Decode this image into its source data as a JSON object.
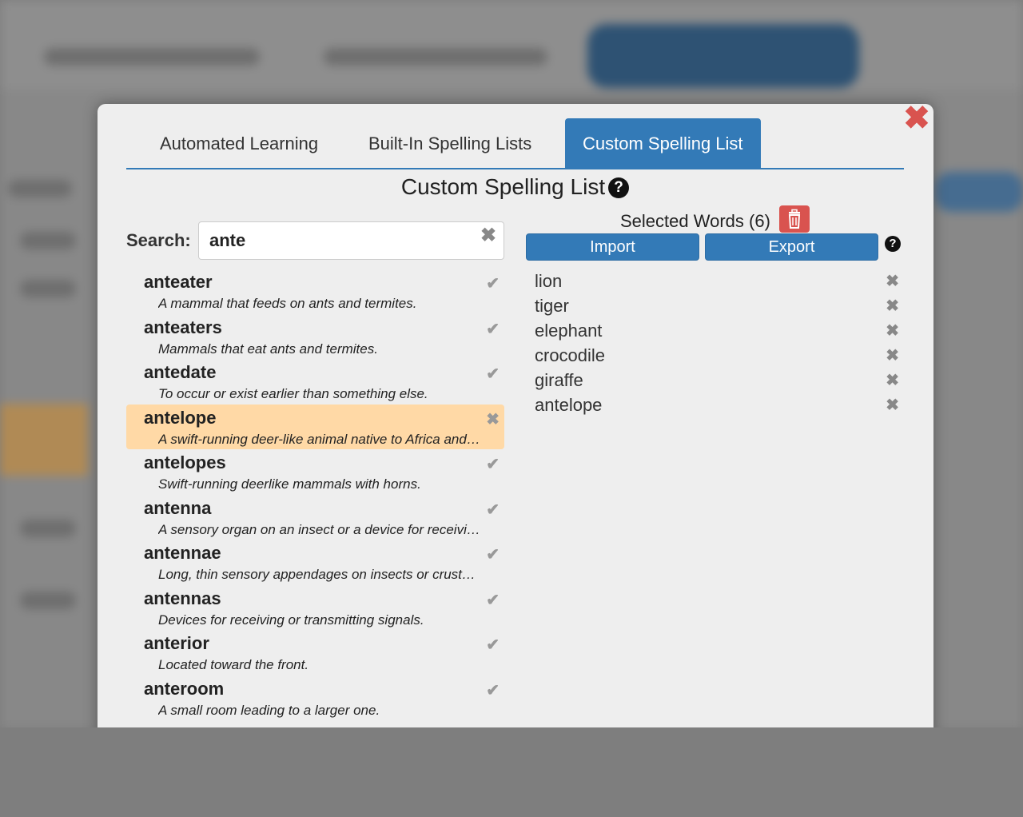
{
  "tabs": [
    {
      "label": "Automated Learning"
    },
    {
      "label": "Built-In Spelling Lists"
    },
    {
      "label": "Custom Spelling List"
    }
  ],
  "title": "Custom Spelling List",
  "search": {
    "label": "Search:",
    "value": "ante"
  },
  "results": [
    {
      "word": "anteater",
      "definition": "A mammal that feeds on ants and termites.",
      "selected": false
    },
    {
      "word": "anteaters",
      "definition": "Mammals that eat ants and termites.",
      "selected": false
    },
    {
      "word": "antedate",
      "definition": "To occur or exist earlier than something else.",
      "selected": false
    },
    {
      "word": "antelope",
      "definition": "A swift-running deer-like animal native to Africa and Asia.",
      "selected": true
    },
    {
      "word": "antelopes",
      "definition": "Swift-running deerlike mammals with horns.",
      "selected": false
    },
    {
      "word": "antenna",
      "definition": "A sensory organ on an insect or a device for receiving signals.",
      "selected": false
    },
    {
      "word": "antennae",
      "definition": "Long, thin sensory appendages on insects or crustaceans.",
      "selected": false
    },
    {
      "word": "antennas",
      "definition": "Devices for receiving or transmitting signals.",
      "selected": false
    },
    {
      "word": "anterior",
      "definition": "Located toward the front.",
      "selected": false
    },
    {
      "word": "anteroom",
      "definition": "A small room leading to a larger one.",
      "selected": false
    }
  ],
  "selected_words": {
    "header": "Selected Words (6)",
    "import_label": "Import",
    "export_label": "Export",
    "words": [
      "lion",
      "tiger",
      "elephant",
      "crocodile",
      "giraffe",
      "antelope"
    ]
  },
  "icons": {
    "close": "close-icon",
    "help": "question-circle-icon",
    "trash": "trash-icon",
    "check": "check-icon",
    "remove": "x-icon"
  },
  "colors": {
    "accent": "#337ab7",
    "danger": "#d9534f",
    "highlight": "#ffd9a6"
  }
}
